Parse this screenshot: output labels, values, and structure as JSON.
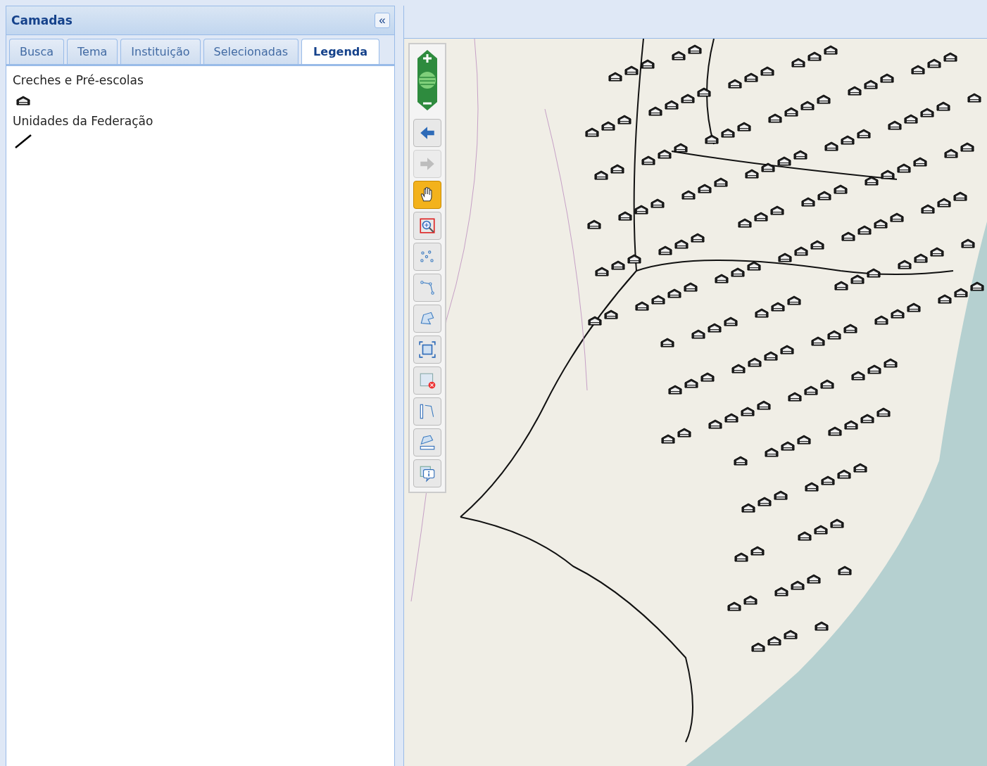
{
  "panel": {
    "title": "Camadas",
    "collapse_icon": "«"
  },
  "tabs": [
    {
      "label": "Busca",
      "selected": false
    },
    {
      "label": "Tema",
      "selected": false
    },
    {
      "label": "Instituição",
      "selected": false
    },
    {
      "label": "Selecionadas",
      "selected": false
    },
    {
      "label": "Legenda",
      "selected": true
    }
  ],
  "legend": [
    {
      "name": "Creches e Pré-escolas",
      "kind": "marker"
    },
    {
      "name": "Unidades da Federação",
      "kind": "line"
    }
  ],
  "tools": [
    {
      "kind": "back",
      "selected": false,
      "disabled": false
    },
    {
      "kind": "forward",
      "selected": false,
      "disabled": true
    },
    {
      "kind": "pan",
      "selected": true,
      "disabled": false
    },
    {
      "kind": "zoombox",
      "selected": false,
      "disabled": false
    },
    {
      "kind": "points",
      "selected": false,
      "disabled": false
    },
    {
      "kind": "line",
      "selected": false,
      "disabled": false
    },
    {
      "kind": "polygon",
      "selected": false,
      "disabled": false
    },
    {
      "kind": "extent",
      "selected": false,
      "disabled": false
    },
    {
      "kind": "clear",
      "selected": false,
      "disabled": false
    },
    {
      "kind": "measureline",
      "selected": false,
      "disabled": false
    },
    {
      "kind": "measurearea",
      "selected": false,
      "disabled": false
    },
    {
      "kind": "info",
      "selected": false,
      "disabled": false
    }
  ]
}
